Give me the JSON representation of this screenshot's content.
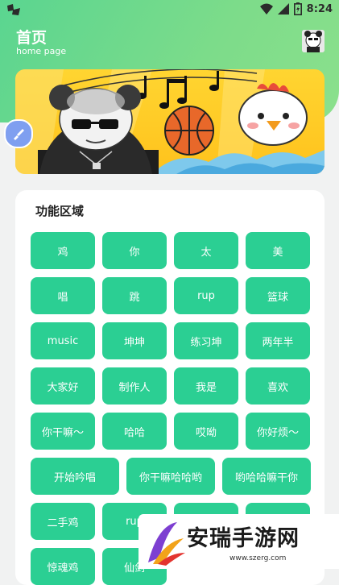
{
  "status": {
    "time": "8:24"
  },
  "header": {
    "title": "首页",
    "subtitle": "home page"
  },
  "section": {
    "title": "功能区域"
  },
  "buttons": [
    [
      "鸡",
      "你",
      "太",
      "美"
    ],
    [
      "唱",
      "跳",
      "rup",
      "篮球"
    ],
    [
      "music",
      "坤坤",
      "练习坤",
      "两年半"
    ],
    [
      "大家好",
      "制作人",
      "我是",
      "喜欢"
    ],
    [
      "你干嘛～",
      "哈哈",
      "哎呦",
      "你好烦～"
    ],
    [
      "开始吟唱",
      "你干嘛哈哈哟",
      "哟哈哈嘛干你"
    ],
    [
      "二手鸡",
      "rup",
      "",
      ""
    ],
    [
      "惊魂鸡",
      "仙剑",
      "",
      ""
    ]
  ],
  "watermark": {
    "text": "安瑞手游网",
    "url": "www.szerg.com"
  },
  "colors": {
    "accent": "#2bcf93",
    "header": "#6fd98c"
  }
}
